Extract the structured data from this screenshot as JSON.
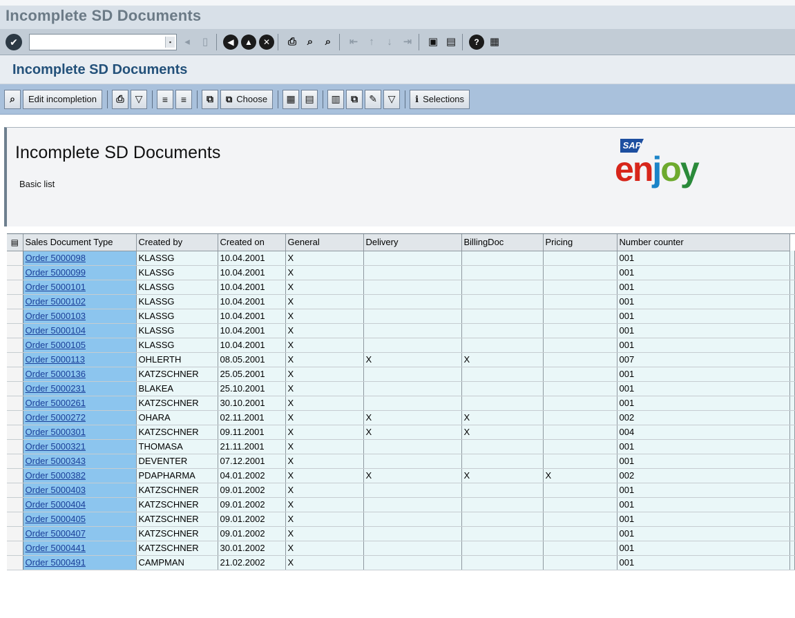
{
  "window": {
    "title": "Incomplete SD Documents"
  },
  "system_toolbar": {
    "command_field_value": ""
  },
  "app": {
    "title": "Incomplete SD Documents"
  },
  "app_toolbar": {
    "edit_incompletion_label": "Edit incompletion",
    "choose_label": "Choose",
    "selections_label": "Selections"
  },
  "header": {
    "title": "Incomplete SD Documents",
    "subtitle": "Basic list",
    "logo_text": "enjoy",
    "logo_brand": "SAP"
  },
  "table": {
    "columns": [
      "Sales Document Type",
      "Created by",
      "Created on",
      "General",
      "Delivery",
      "BillingDoc",
      "Pricing",
      "Number counter"
    ],
    "rows": [
      [
        "Order 5000098",
        "KLASSG",
        "10.04.2001",
        "X",
        "",
        "",
        "",
        "001"
      ],
      [
        "Order 5000099",
        "KLASSG",
        "10.04.2001",
        "X",
        "",
        "",
        "",
        "001"
      ],
      [
        "Order 5000101",
        "KLASSG",
        "10.04.2001",
        "X",
        "",
        "",
        "",
        "001"
      ],
      [
        "Order 5000102",
        "KLASSG",
        "10.04.2001",
        "X",
        "",
        "",
        "",
        "001"
      ],
      [
        "Order 5000103",
        "KLASSG",
        "10.04.2001",
        "X",
        "",
        "",
        "",
        "001"
      ],
      [
        "Order 5000104",
        "KLASSG",
        "10.04.2001",
        "X",
        "",
        "",
        "",
        "001"
      ],
      [
        "Order 5000105",
        "KLASSG",
        "10.04.2001",
        "X",
        "",
        "",
        "",
        "001"
      ],
      [
        "Order 5000113",
        "OHLERTH",
        "08.05.2001",
        "X",
        "X",
        "X",
        "",
        "007"
      ],
      [
        "Order 5000136",
        "KATZSCHNER",
        "25.05.2001",
        "X",
        "",
        "",
        "",
        "001"
      ],
      [
        "Order 5000231",
        "BLAKEA",
        "25.10.2001",
        "X",
        "",
        "",
        "",
        "001"
      ],
      [
        "Order 5000261",
        "KATZSCHNER",
        "30.10.2001",
        "X",
        "",
        "",
        "",
        "001"
      ],
      [
        "Order 5000272",
        "OHARA",
        "02.11.2001",
        "X",
        "X",
        "X",
        "",
        "002"
      ],
      [
        "Order 5000301",
        "KATZSCHNER",
        "09.11.2001",
        "X",
        "X",
        "X",
        "",
        "004"
      ],
      [
        "Order 5000321",
        "THOMASA",
        "21.11.2001",
        "X",
        "",
        "",
        "",
        "001"
      ],
      [
        "Order 5000343",
        "DEVENTER",
        "07.12.2001",
        "X",
        "",
        "",
        "",
        "001"
      ],
      [
        "Order 5000382",
        "PDAPHARMA",
        "04.01.2002",
        "X",
        "X",
        "X",
        "X",
        "002"
      ],
      [
        "Order 5000403",
        "KATZSCHNER",
        "09.01.2002",
        "X",
        "",
        "",
        "",
        "001"
      ],
      [
        "Order 5000404",
        "KATZSCHNER",
        "09.01.2002",
        "X",
        "",
        "",
        "",
        "001"
      ],
      [
        "Order 5000405",
        "KATZSCHNER",
        "09.01.2002",
        "X",
        "",
        "",
        "",
        "001"
      ],
      [
        "Order 5000407",
        "KATZSCHNER",
        "09.01.2002",
        "X",
        "",
        "",
        "",
        "001"
      ],
      [
        "Order 5000441",
        "KATZSCHNER",
        "30.01.2002",
        "X",
        "",
        "",
        "",
        "001"
      ],
      [
        "Order 5000491",
        "CAMPMAN",
        "21.02.2002",
        "X",
        "",
        "",
        "",
        "001"
      ]
    ]
  },
  "colors": {
    "app_toolbar_bg": "#a9c1dc",
    "key_column_bg": "#8cc5ee",
    "row_bg": "#eaf7f8",
    "title_color": "#23517a"
  }
}
